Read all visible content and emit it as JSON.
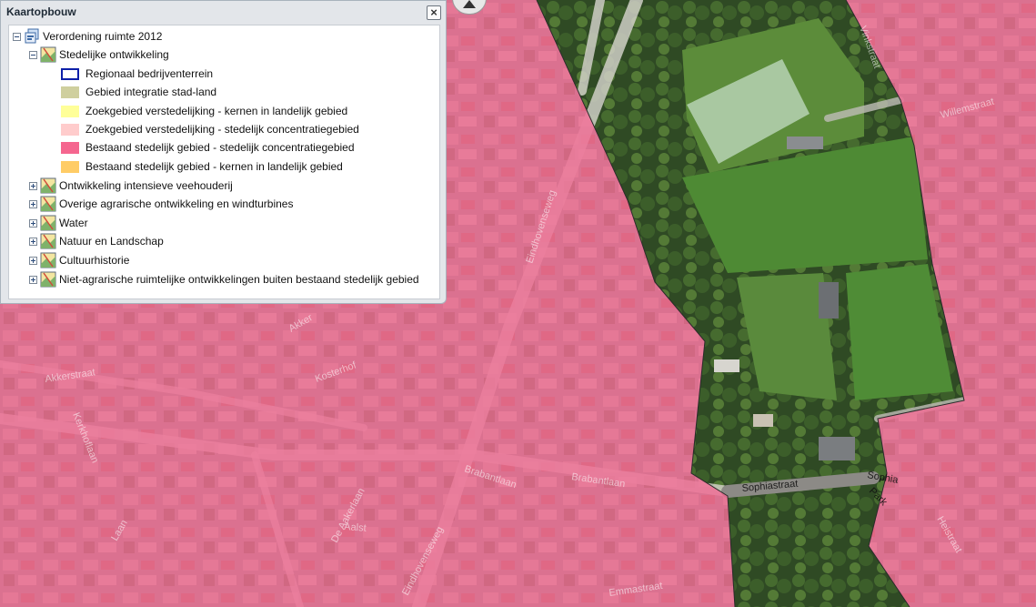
{
  "panel": {
    "title": "Kaartopbouw",
    "close_label": "×",
    "root": {
      "label": "Verordening ruimte 2012"
    },
    "group": {
      "label": "Stedelijke ontwikkeling",
      "legend": [
        {
          "label": "Regionaal bedrijventerrein",
          "fill": "#ffffff",
          "border": "#0d1fa8"
        },
        {
          "label": "Gebied integratie stad-land",
          "fill": "#cfcf9e",
          "border": "#cfcf9e"
        },
        {
          "label": "Zoekgebied verstedelijking - kernen in landelijk gebied",
          "fill": "#ffff99",
          "border": "#ffff99"
        },
        {
          "label": "Zoekgebied verstedelijking - stedelijk concentratiegebied",
          "fill": "#ffcccc",
          "border": "#ffcccc"
        },
        {
          "label": "Bestaand stedelijk gebied - stedelijk concentratiegebied",
          "fill": "#f5668f",
          "border": "#f5668f"
        },
        {
          "label": "Bestaand stedelijk gebied - kernen in landelijk gebied",
          "fill": "#ffcc66",
          "border": "#ffcc66"
        }
      ]
    },
    "collapsed_layers": [
      {
        "label": "Ontwikkeling intensieve veehouderij"
      },
      {
        "label": "Overige agrarische ontwikkeling en windturbines"
      },
      {
        "label": "Water"
      },
      {
        "label": "Natuur en Landschap"
      },
      {
        "label": "Cultuurhistorie"
      },
      {
        "label": "Niet-agrarische ruimtelijke ontwikkelingen buiten bestaand stedelijk gebied"
      }
    ]
  },
  "map": {
    "overlay_color": "#f1668f",
    "labels": {
      "aalst": "Aalst",
      "brabantlaan_1": "Brabantlaan",
      "brabantlaan_2": "Brabantlaan",
      "eindhovenseweg_1": "Eindhovenseweg",
      "eindhovenseweg_2": "Eindhovenseweg",
      "sophiastraat": "Sophiastraat",
      "sophia_park_1": "Sophia",
      "sophia_park_2": "Park",
      "willemstraat": "Willemstraat",
      "akkerstraat": "Akkerstraat",
      "kerkhoflaan": "Kerkhoflaan",
      "kosterhof": "Kosterhof",
      "de_aakerlaan": "De Aakerlaan",
      "laan_west": "Laan",
      "emmastraat": "Emmastraat",
      "heistraat": "Heistraat",
      "vinkstraat": "Vinkstraat",
      "akker_noord": "Akker"
    }
  }
}
